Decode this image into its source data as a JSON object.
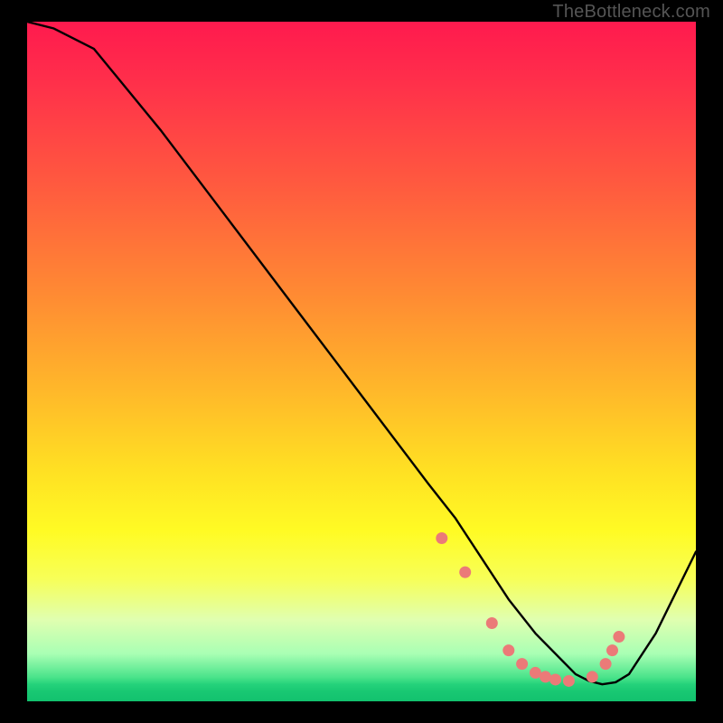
{
  "watermark": "TheBottleneck.com",
  "chart_data": {
    "type": "line",
    "title": "",
    "xlabel": "",
    "ylabel": "",
    "xlim": [
      0,
      100
    ],
    "ylim": [
      0,
      100
    ],
    "series": [
      {
        "name": "curve",
        "x": [
          0,
          4,
          10,
          20,
          30,
          40,
          50,
          60,
          64,
          68,
          72,
          76,
          80,
          82,
          84,
          86,
          88,
          90,
          94,
          100
        ],
        "y": [
          100,
          99,
          96,
          84,
          71,
          58,
          45,
          32,
          27,
          21,
          15,
          10,
          6,
          4,
          3,
          2.5,
          2.8,
          4,
          10,
          22
        ]
      }
    ],
    "markers": {
      "name": "dots",
      "x": [
        62,
        65.5,
        69.5,
        72,
        74,
        76,
        77.5,
        79,
        81,
        84.5,
        86.5,
        87.5,
        88.5
      ],
      "y": [
        24,
        19,
        11.5,
        7.5,
        5.5,
        4.2,
        3.6,
        3.2,
        3.0,
        3.6,
        5.5,
        7.5,
        9.5
      ]
    },
    "colors": {
      "line": "#000000",
      "marker": "#eb7a78"
    }
  }
}
